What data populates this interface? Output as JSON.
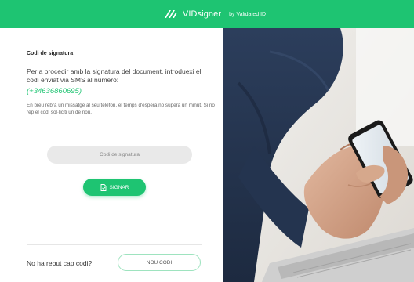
{
  "brand": {
    "name": "VIDsigner",
    "by": "by Validated ID",
    "logo_icon": "vidsigner-logo-icon"
  },
  "form": {
    "title": "Codi de signatura",
    "intro": "Per a procedir amb la signatura del document, introduexi el codi enviat via SMS al número:",
    "phone": "(+34636860695)",
    "note": "En breu rebrà un missatge al seu telèfon, el temps d'espera no supera un minut. Si no rep el codi sol·liciti un de nou.",
    "code_placeholder": "Codi de signatura",
    "code_value": "",
    "sign_label": "SIGNAR",
    "sign_icon": "sign-document-icon",
    "no_code_label": "No ha rebut cap codi?",
    "new_code_label": "NOU CODI"
  },
  "colors": {
    "accent": "#1ec472",
    "input_bg": "#e9e9e9",
    "text": "#333333"
  }
}
